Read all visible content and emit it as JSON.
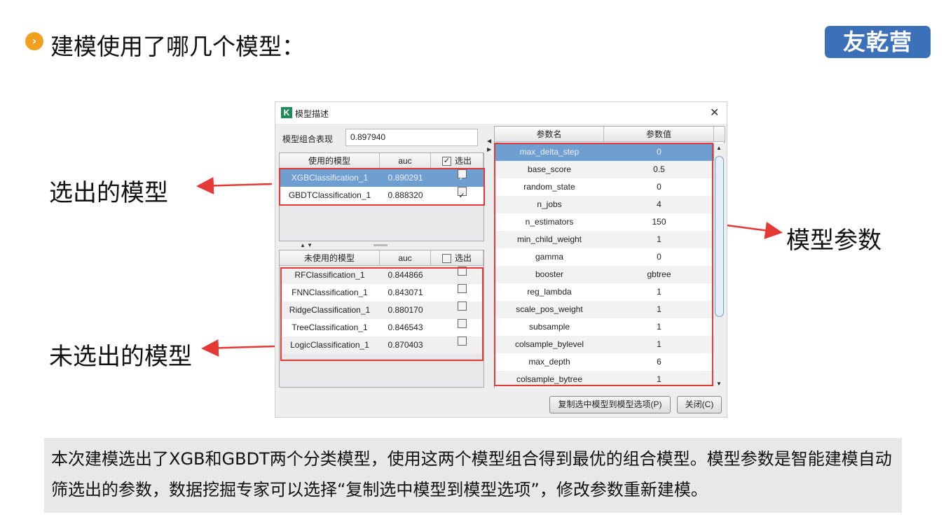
{
  "slide": {
    "bullet_icon": "chevron-right-icon",
    "title": "建模使用了哪几个模型：",
    "logo": "友乾营",
    "annotations": {
      "selected": "选出的模型",
      "unselected": "未选出的模型",
      "params": "模型参数"
    },
    "caption": "本次建模选出了XGB和GBDT两个分类模型，使用这两个模型组合得到最优的组合模型。模型参数是智能建模自动筛选出的参数，数据挖掘专家可以选择“复制选中模型到模型选项”，修改参数重新建模。"
  },
  "dialog": {
    "title": "模型描述",
    "combo_label": "模型组合表现",
    "combo_value": "0.897940",
    "used": {
      "headers": [
        "使用的模型",
        "auc",
        "选出"
      ],
      "rows": [
        [
          "XGBClassification_1",
          "0.890291",
          true
        ],
        [
          "GBDTClassification_1",
          "0.888320",
          true
        ]
      ]
    },
    "unused": {
      "headers": [
        "未使用的模型",
        "auc",
        "选出"
      ],
      "rows": [
        [
          "RFClassification_1",
          "0.844866",
          false
        ],
        [
          "FNNClassification_1",
          "0.843071",
          false
        ],
        [
          "RidgeClassification_1",
          "0.880170",
          false
        ],
        [
          "TreeClassification_1",
          "0.846543",
          false
        ],
        [
          "LogicClassification_1",
          "0.870403",
          false
        ]
      ]
    },
    "params": {
      "headers": [
        "参数名",
        "参数值"
      ],
      "rows": [
        [
          "max_delta_step",
          "0"
        ],
        [
          "base_score",
          "0.5"
        ],
        [
          "random_state",
          "0"
        ],
        [
          "n_jobs",
          "4"
        ],
        [
          "n_estimators",
          "150"
        ],
        [
          "min_child_weight",
          "1"
        ],
        [
          "gamma",
          "0"
        ],
        [
          "booster",
          "gbtree"
        ],
        [
          "reg_lambda",
          "1"
        ],
        [
          "scale_pos_weight",
          "1"
        ],
        [
          "subsample",
          "1"
        ],
        [
          "colsample_bylevel",
          "1"
        ],
        [
          "max_depth",
          "6"
        ],
        [
          "colsample_bytree",
          "1"
        ]
      ]
    },
    "copy_button": "复制选中模型到模型选项(P)",
    "close_button": "关闭(C)"
  },
  "colors": {
    "selected_row": "#6f9fd0",
    "annotation": "#e53935",
    "logo": "#3c70b8"
  }
}
